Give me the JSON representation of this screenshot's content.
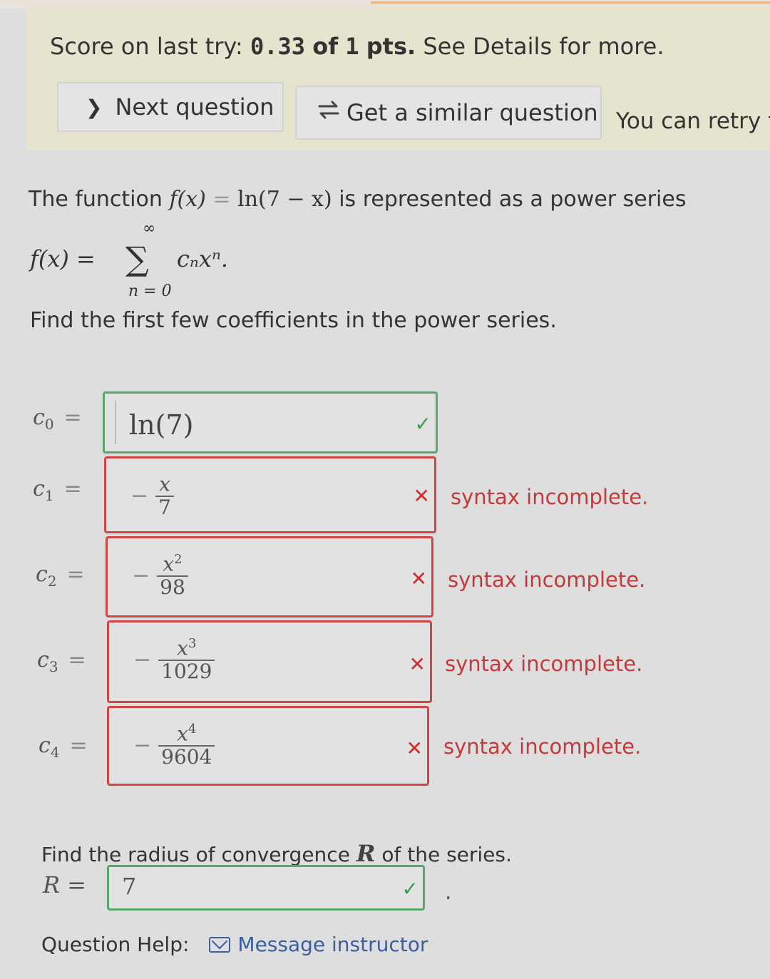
{
  "score": {
    "prefix": "Score on last try:",
    "value": "0.33",
    "of": "of",
    "total": "1",
    "pts": "pts.",
    "suffix": "See Details for more."
  },
  "buttons": {
    "next_label": "Next question",
    "similar_label": "Get a similar question",
    "retry_text": "You can retry t"
  },
  "problem": {
    "intro": "The function",
    "func_lhs": "f(x)",
    "equals": "=",
    "func_rhs": "ln(7 − x)",
    "intro_tail": "is represented as a power series",
    "series_lhs": "f(x) =",
    "sigma": "∑",
    "sigma_top": "∞",
    "sigma_bottom": "n = 0",
    "series_term": "cₙxⁿ.",
    "instruction": "Find the first few coefficients in the power series."
  },
  "coefficients": [
    {
      "label": "c",
      "sub": "0",
      "answer": "ln(7)",
      "status": "correct"
    },
    {
      "label": "c",
      "sub": "1",
      "sign": "−",
      "numerator": "x",
      "power": "",
      "denominator": "7",
      "status": "incorrect",
      "message": "syntax incomplete."
    },
    {
      "label": "c",
      "sub": "2",
      "sign": "−",
      "numerator": "x",
      "power": "2",
      "denominator": "98",
      "status": "incorrect",
      "message": "syntax incomplete."
    },
    {
      "label": "c",
      "sub": "3",
      "sign": "−",
      "numerator": "x",
      "power": "3",
      "denominator": "1029",
      "status": "incorrect",
      "message": "syntax incomplete."
    },
    {
      "label": "c",
      "sub": "4",
      "sign": "−",
      "numerator": "x",
      "power": "4",
      "denominator": "9604",
      "status": "incorrect",
      "message": "syntax incomplete."
    }
  ],
  "radius": {
    "question_pre": "Find the radius of convergence",
    "variable": "R",
    "question_post": "of the series.",
    "label": "R =",
    "answer": "7",
    "status": "correct"
  },
  "help": {
    "label": "Question Help:",
    "link": "Message instructor"
  },
  "colors": {
    "correct": "#58a86a",
    "incorrect": "#d24545",
    "link": "#3b5ea0"
  }
}
